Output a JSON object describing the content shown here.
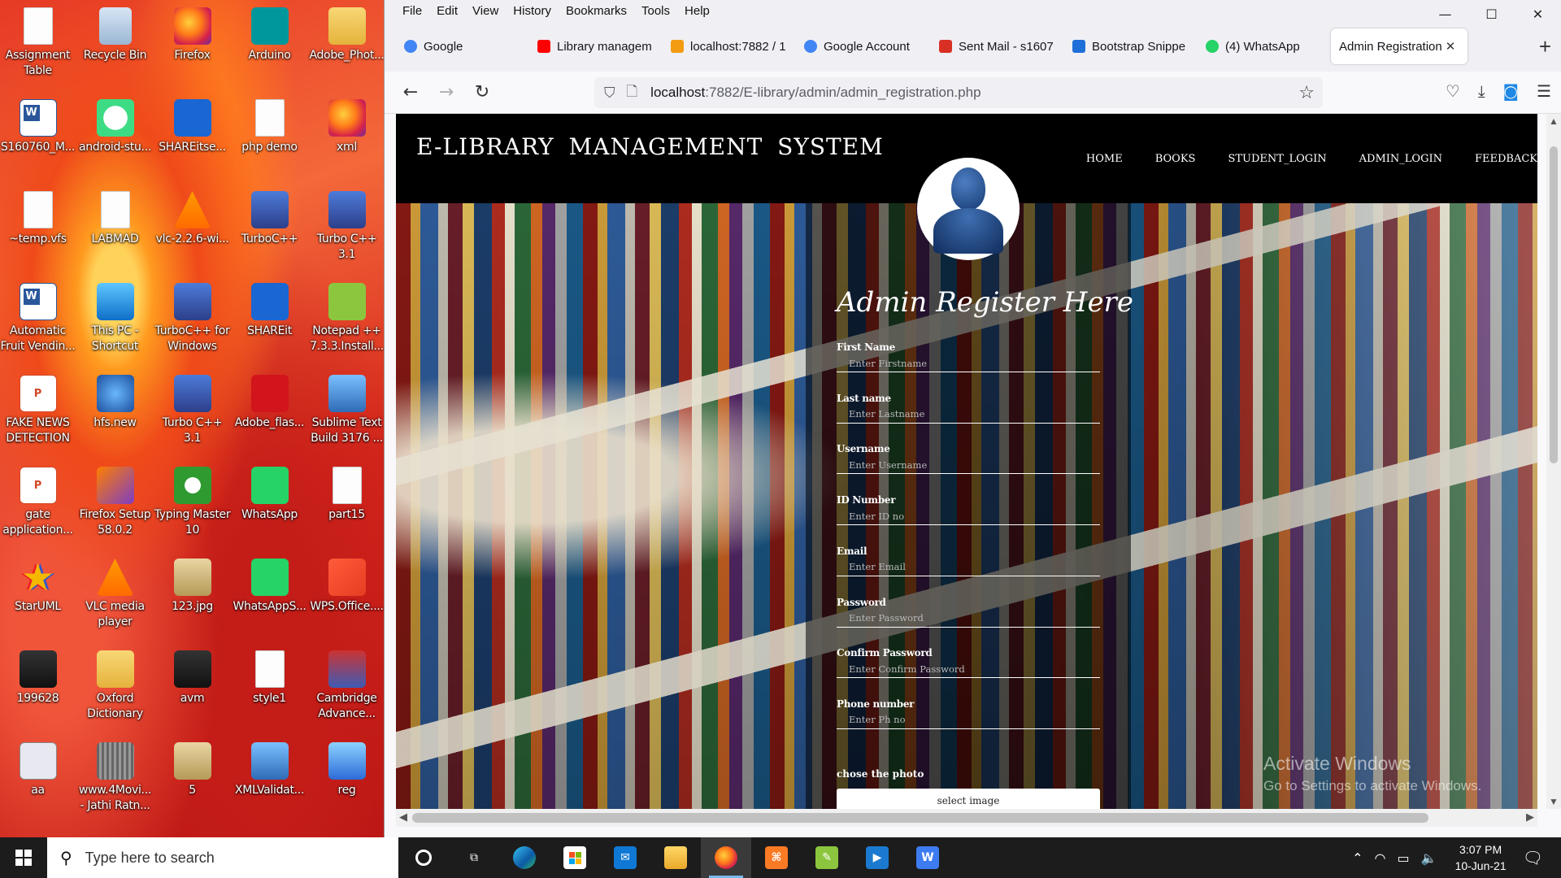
{
  "desktop": {
    "icons": [
      {
        "label": "Assignment Table",
        "icon": "document-icon"
      },
      {
        "label": "Recycle Bin",
        "icon": "recycle-bin-icon"
      },
      {
        "label": "Firefox",
        "icon": "firefox-icon"
      },
      {
        "label": "Arduino",
        "icon": "arduino-icon"
      },
      {
        "label": "Adobe_Phot...",
        "icon": "folder-icon"
      },
      {
        "label": "S160760_M...",
        "icon": "word-icon"
      },
      {
        "label": "android-stu...",
        "icon": "android-studio-icon"
      },
      {
        "label": "SHAREitse...",
        "icon": "shareit-icon"
      },
      {
        "label": "php demo",
        "icon": "php-icon"
      },
      {
        "label": "xml",
        "icon": "firefox-icon"
      },
      {
        "label": "~temp.vfs",
        "icon": "document-icon"
      },
      {
        "label": "LABMAD",
        "icon": "document-icon"
      },
      {
        "label": "vlc-2.2.6-wi...",
        "icon": "vlc-icon"
      },
      {
        "label": "TurboC++",
        "icon": "turbo-cpp-icon"
      },
      {
        "label": "Turbo C++ 3.1",
        "icon": "turbo-cpp-icon"
      },
      {
        "label": "Automatic Fruit Vendin...",
        "icon": "word-icon"
      },
      {
        "label": "This PC - Shortcut",
        "icon": "this-pc-icon"
      },
      {
        "label": "TurboC++ for Windows",
        "icon": "turbo-cpp-icon"
      },
      {
        "label": "SHAREit",
        "icon": "shareit-icon"
      },
      {
        "label": "Notepad ++ 7.3.3.Install...",
        "icon": "notepad-plus-icon"
      },
      {
        "label": "FAKE NEWS DETECTION",
        "icon": "pdf-icon"
      },
      {
        "label": "hfs.new",
        "icon": "globe-icon"
      },
      {
        "label": "Turbo C++ 3.1",
        "icon": "turbo-cpp-icon"
      },
      {
        "label": "Adobe_flas...",
        "icon": "flash-icon"
      },
      {
        "label": "Sublime Text Build 3176 ...",
        "icon": "installer-icon"
      },
      {
        "label": "gate application...",
        "icon": "pdf-icon"
      },
      {
        "label": "Firefox Setup 58.0.2",
        "icon": "firefox-setup-icon"
      },
      {
        "label": "Typing Master 10",
        "icon": "typing-master-icon"
      },
      {
        "label": "WhatsApp",
        "icon": "whatsapp-icon"
      },
      {
        "label": "part15",
        "icon": "document-icon"
      },
      {
        "label": "StarUML",
        "icon": "staruml-icon"
      },
      {
        "label": "VLC media player",
        "icon": "vlc-icon"
      },
      {
        "label": "123.jpg",
        "icon": "image-icon"
      },
      {
        "label": "WhatsAppS...",
        "icon": "whatsapp-icon"
      },
      {
        "label": "WPS.Office....",
        "icon": "wps-icon"
      },
      {
        "label": "199628",
        "icon": "video-icon"
      },
      {
        "label": "Oxford Dictionary",
        "icon": "folder-icon"
      },
      {
        "label": "avm",
        "icon": "video-icon"
      },
      {
        "label": "style1",
        "icon": "document-icon"
      },
      {
        "label": "Cambridge Advance...",
        "icon": "cambridge-icon"
      },
      {
        "label": "aa",
        "icon": "c-file-icon"
      },
      {
        "label": "www.4Movi... - Jathi Ratn...",
        "icon": "movie-icon"
      },
      {
        "label": "5",
        "icon": "image-icon"
      },
      {
        "label": "XMLValidat...",
        "icon": "installer-icon"
      },
      {
        "label": "reg",
        "icon": "registry-icon"
      }
    ]
  },
  "browser": {
    "menu": [
      "File",
      "Edit",
      "View",
      "History",
      "Bookmarks",
      "Tools",
      "Help"
    ],
    "tabs": [
      {
        "label": "Google",
        "icon": "google-icon",
        "color": "#4285f4"
      },
      {
        "label": "Library managem",
        "icon": "youtube-icon",
        "color": "#ff0000"
      },
      {
        "label": "localhost:7882 / 1",
        "icon": "phpmyadmin-icon",
        "color": "#f39c12"
      },
      {
        "label": "Google Account",
        "icon": "google-icon",
        "color": "#4285f4"
      },
      {
        "label": "Sent Mail - s1607",
        "icon": "gmail-icon",
        "color": "#d93025"
      },
      {
        "label": "Bootstrap Snippe",
        "icon": "bootstrap-icon",
        "color": "#1e6fd8"
      },
      {
        "label": "(4) WhatsApp",
        "icon": "whatsapp-icon",
        "color": "#25d366"
      },
      {
        "label": "Admin Registration",
        "icon": "",
        "color": "#ffffff",
        "active": true
      }
    ],
    "url_host": "localhost",
    "url_rest": ":7882/E-library/admin/admin_registration.php"
  },
  "site": {
    "title": "E-LIBRARY  MANAGEMENT  SYSTEM",
    "nav": [
      "HOME",
      "BOOKS",
      "STUDENT_LOGIN",
      "ADMIN_LOGIN",
      "FEEDBACK"
    ],
    "form_title": "Admin Register Here",
    "fields": [
      {
        "label": "First Name",
        "placeholder": "Enter Firstname"
      },
      {
        "label": "Last name",
        "placeholder": "Enter Lastname"
      },
      {
        "label": "Username",
        "placeholder": "Enter Username"
      },
      {
        "label": "ID Number",
        "placeholder": "Enter ID no"
      },
      {
        "label": "Email",
        "placeholder": "Enter Email"
      },
      {
        "label": "Password",
        "placeholder": "Enter Password"
      },
      {
        "label": "Confirm Password",
        "placeholder": "Enter Confirm Password"
      },
      {
        "label": "Phone number",
        "placeholder": "Enter Ph no"
      }
    ],
    "photo_label": "chose the photo",
    "photo_button": "select image"
  },
  "watermark": {
    "line1": "Activate Windows",
    "line2": "Go to Settings to activate Windows."
  },
  "taskbar": {
    "search_placeholder": "Type here to search",
    "time": "3:07 PM",
    "date": "10-Jun-21"
  }
}
